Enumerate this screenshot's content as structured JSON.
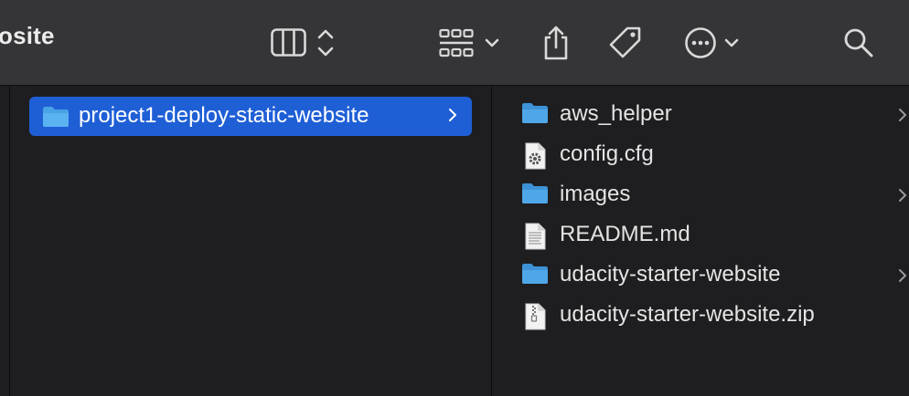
{
  "window": {
    "title": "osite"
  },
  "toolbar": {
    "icons": [
      "column-view-icon",
      "view-switcher-chevron-icon",
      "grid-group-icon",
      "dropdown-chevron-icon",
      "share-icon",
      "tag-icon",
      "more-actions-icon",
      "more-chevron-icon",
      "search-icon"
    ]
  },
  "colors": {
    "selection": "#1f5fd6",
    "folder": "#48a3e6",
    "toolbar_bg": "#353537",
    "content_bg": "#1e1e20"
  },
  "columns": {
    "parent": {
      "selected": {
        "name": "project1-deploy-static-website",
        "icon": "folder-icon",
        "has_children": true
      }
    },
    "contents": {
      "items": [
        {
          "name": "aws_helper",
          "icon": "folder-icon",
          "has_children": true
        },
        {
          "name": "config.cfg",
          "icon": "config-file-icon",
          "has_children": false
        },
        {
          "name": "images",
          "icon": "folder-icon",
          "has_children": true
        },
        {
          "name": "README.md",
          "icon": "text-file-icon",
          "has_children": false
        },
        {
          "name": "udacity-starter-website",
          "icon": "folder-icon",
          "has_children": true
        },
        {
          "name": "udacity-starter-website.zip",
          "icon": "zip-file-icon",
          "has_children": false
        }
      ]
    }
  }
}
